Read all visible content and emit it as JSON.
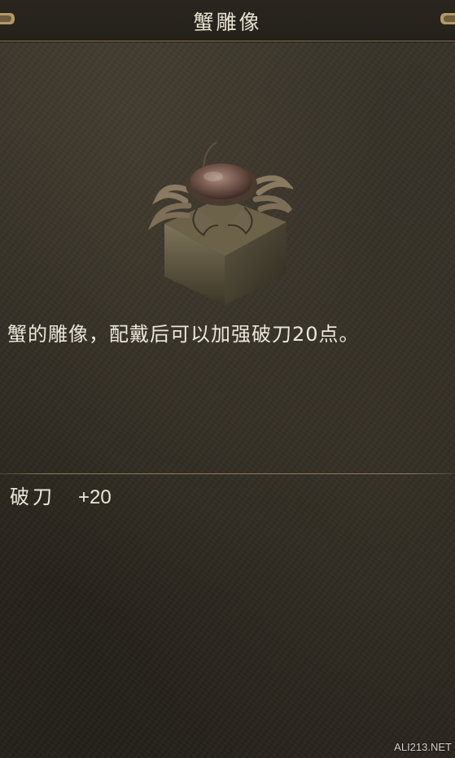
{
  "item": {
    "title": "蟹雕像",
    "icon": "crab-statue-icon",
    "description": "蟹的雕像，配戴后可以加强破刀20点。",
    "stats": [
      {
        "name": "破刀",
        "value": "+20"
      }
    ]
  },
  "watermark": "ALI213.NET",
  "colors": {
    "background": "#302b22",
    "text": "#ece7da",
    "divider": "#8c7c5c"
  }
}
